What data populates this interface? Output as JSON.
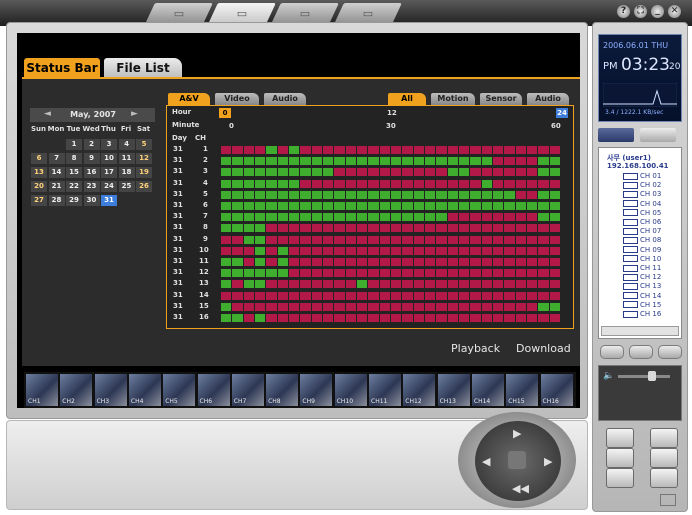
{
  "top_tabs": [
    {
      "icon": "monitor-icon"
    },
    {
      "icon": "playback-icon",
      "selected": true
    },
    {
      "icon": "search-icon"
    },
    {
      "icon": "setup-icon"
    }
  ],
  "window_buttons": [
    "?",
    "⛶",
    "_",
    "✕"
  ],
  "tabs": {
    "status": "Status Bar",
    "file": "File List"
  },
  "calendar": {
    "month": "May, 2007",
    "prev": "◄",
    "next": "►",
    "weekdays": [
      "Sun",
      "Mon",
      "Tue",
      "Wed",
      "Thu",
      "Fri",
      "Sat"
    ],
    "weeks": [
      [
        "",
        "",
        "1",
        "2",
        "3",
        "4",
        "5"
      ],
      [
        "6",
        "7",
        "8",
        "9",
        "10",
        "11",
        "12"
      ],
      [
        "13",
        "14",
        "15",
        "16",
        "17",
        "18",
        "19"
      ],
      [
        "20",
        "21",
        "22",
        "23",
        "24",
        "25",
        "26"
      ],
      [
        "27",
        "28",
        "29",
        "30",
        "31",
        "",
        ""
      ]
    ],
    "selected": "31"
  },
  "source_tabs": [
    {
      "label": "A&V",
      "active": true
    },
    {
      "label": "Video"
    },
    {
      "label": "Audio"
    }
  ],
  "filter_tabs": [
    {
      "label": "All",
      "active": true
    },
    {
      "label": "Motion"
    },
    {
      "label": "Sensor"
    },
    {
      "label": "Audio"
    }
  ],
  "timeline": {
    "hour_label": "Hour",
    "minute_label": "Minute",
    "day_label": "Day",
    "ch_label": "CH",
    "hour_start": "0",
    "hour_mid": "12",
    "hour_end": "24",
    "min_start": "0",
    "min_mid": "30",
    "min_end": "60",
    "colors": {
      "green": "#3fae2e",
      "red": "#b31948"
    },
    "rows": [
      {
        "day": "31",
        "ch": "1",
        "segs": "RRRRGRGRRRRRRRRRRRRRRRRRRRRRRR"
      },
      {
        "day": "31",
        "ch": "2",
        "segs": "GGGGGGGGGGGGGGGGGGGGGGGGRRRRGG"
      },
      {
        "day": "31",
        "ch": "3",
        "segs": "GGGGGGGGGGRRRRRRRRRRGGRRRRRRGG"
      },
      {
        "day": "31",
        "ch": "4",
        "segs": "GGGGGGGRRRRRRRRRRRRRRRRGRRRRRR"
      },
      {
        "day": "31",
        "ch": "5",
        "segs": "GGGGGGGGGGGGGGGGGGGGGGGGGGRRGG"
      },
      {
        "day": "31",
        "ch": "6",
        "segs": "GGGGGGGGGGGGGGGGGGGGGGGGGGGGGG"
      },
      {
        "day": "31",
        "ch": "7",
        "segs": "GGGGGGGGGGGGGGGGGGGGRRRRRRRRGG"
      },
      {
        "day": "31",
        "ch": "8",
        "segs": "GGGGRRRRRRRRRRRRRRRRRRRRRRRRRR"
      },
      {
        "day": "31",
        "ch": "9",
        "segs": "RRGGRRRRRRRRRRRRRRRRRRRRRRRRRR"
      },
      {
        "day": "31",
        "ch": "10",
        "segs": "RRRGRGRRRRRRRRRRRRRRRRRRRRRRRR"
      },
      {
        "day": "31",
        "ch": "11",
        "segs": "GGRGRGRRRRRRRRRRRRRRRRRRRRRRRR"
      },
      {
        "day": "31",
        "ch": "12",
        "segs": "GGGGGGRRRRRRRRRRRRRRRRRRRRRRRR"
      },
      {
        "day": "31",
        "ch": "13",
        "segs": "GRGGRRRRRRRRGRRRRRRRRRRRRRRRRR"
      },
      {
        "day": "31",
        "ch": "14",
        "segs": "RRRRRRRRRRRRRRRRRRRRRRRRRRRRRR"
      },
      {
        "day": "31",
        "ch": "15",
        "segs": "GRRRRRRRRRRRRRRRRRRRRRRRRRRRGG"
      },
      {
        "day": "31",
        "ch": "16",
        "segs": "GGRGRRRRRRRRRRRRRRRRRRRRRRRRRR"
      }
    ]
  },
  "buttons": {
    "playback": "Playback",
    "download": "Download"
  },
  "thumbnails": [
    "CH1",
    "CH2",
    "CH3",
    "CH4",
    "CH5",
    "CH6",
    "CH7",
    "CH8",
    "CH9",
    "CH10",
    "CH11",
    "CH12",
    "CH13",
    "CH14",
    "CH15",
    "CH16"
  ],
  "clock": {
    "date": "2006.06.01 THU",
    "ampm": "PM",
    "time": "03:23",
    "sec": "20",
    "rate": "3.4 / 1222.1 KB/sec"
  },
  "channel_tree": {
    "user": "사무 (user1)",
    "ip": "192.168.100.41",
    "channels": [
      "CH 01",
      "CH 02",
      "CH 03",
      "CH 04",
      "CH 05",
      "CH 06",
      "CH 07",
      "CH 08",
      "CH 09",
      "CH 10",
      "CH 11",
      "CH 12",
      "CH 13",
      "CH 14",
      "CH 15",
      "CH 16"
    ]
  }
}
